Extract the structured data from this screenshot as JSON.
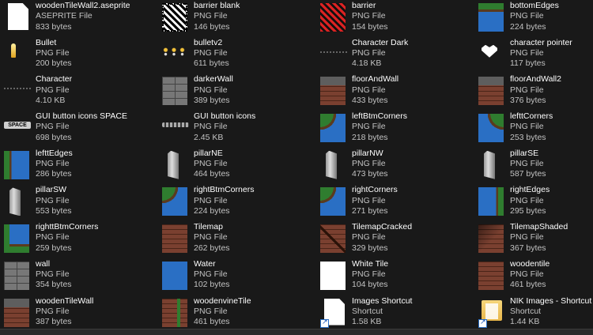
{
  "files": [
    {
      "name": "woodenTileWall2.aseprite",
      "type": "ASEPRITE File",
      "size": "833 bytes",
      "thumb": "doc"
    },
    {
      "name": "barrier blank",
      "type": "PNG File",
      "size": "146 bytes",
      "thumb": "blank"
    },
    {
      "name": "barrier",
      "type": "PNG File",
      "size": "154 bytes",
      "thumb": "barrier"
    },
    {
      "name": "bottomEdges",
      "type": "PNG File",
      "size": "224 bytes",
      "thumb": "grass-top"
    },
    {
      "name": "Bullet",
      "type": "PNG File",
      "size": "200 bytes",
      "thumb": "bullet"
    },
    {
      "name": "bulletv2",
      "type": "PNG File",
      "size": "611 bytes",
      "thumb": "bullets"
    },
    {
      "name": "Character Dark",
      "type": "PNG File",
      "size": "4.18 KB",
      "thumb": "strip"
    },
    {
      "name": "character pointer",
      "type": "PNG File",
      "size": "117 bytes",
      "thumb": "heart"
    },
    {
      "name": "Character",
      "type": "PNG File",
      "size": "4.10 KB",
      "thumb": "strip"
    },
    {
      "name": "darkerWall",
      "type": "PNG File",
      "size": "389 bytes",
      "thumb": "stone"
    },
    {
      "name": "floorAndWall",
      "type": "PNG File",
      "size": "433 bytes",
      "thumb": "wood-floor"
    },
    {
      "name": "floorAndWall2",
      "type": "PNG File",
      "size": "376 bytes",
      "thumb": "wood-floor"
    },
    {
      "name": "GUI button icons SPACE",
      "type": "PNG File",
      "size": "698 bytes",
      "thumb": "space",
      "thumb_text": "SPACE"
    },
    {
      "name": "GUI button icons",
      "type": "PNG File",
      "size": "2.45 KB",
      "thumb": "gui"
    },
    {
      "name": "leftBtmCorners",
      "type": "PNG File",
      "size": "218 bytes",
      "thumb": "corner-tl"
    },
    {
      "name": "lefttCorners",
      "type": "PNG File",
      "size": "253 bytes",
      "thumb": "corner-tr"
    },
    {
      "name": "lefttEdges",
      "type": "PNG File",
      "size": "286 bytes",
      "thumb": "grass-left"
    },
    {
      "name": "pillarNE",
      "type": "PNG File",
      "size": "464 bytes",
      "thumb": "pillar"
    },
    {
      "name": "pillarNW",
      "type": "PNG File",
      "size": "473 bytes",
      "thumb": "pillar"
    },
    {
      "name": "pillarSE",
      "type": "PNG File",
      "size": "587 bytes",
      "thumb": "pillar"
    },
    {
      "name": "pillarSW",
      "type": "PNG File",
      "size": "553 bytes",
      "thumb": "pillar"
    },
    {
      "name": "rightBtmCorners",
      "type": "PNG File",
      "size": "224 bytes",
      "thumb": "corner-tl"
    },
    {
      "name": "rightCorners",
      "type": "PNG File",
      "size": "271 bytes",
      "thumb": "corner-tl"
    },
    {
      "name": "rightEdges",
      "type": "PNG File",
      "size": "295 bytes",
      "thumb": "grass-right"
    },
    {
      "name": "righttBtmCorners",
      "type": "PNG File",
      "size": "259 bytes",
      "thumb": "corner-bl"
    },
    {
      "name": "Tilemap",
      "type": "PNG File",
      "size": "262 bytes",
      "thumb": "wood"
    },
    {
      "name": "TilemapCracked",
      "type": "PNG File",
      "size": "329 bytes",
      "thumb": "wood-crack"
    },
    {
      "name": "TilemapShaded",
      "type": "PNG File",
      "size": "367 bytes",
      "thumb": "wood-shade"
    },
    {
      "name": "wall",
      "type": "PNG File",
      "size": "354 bytes",
      "thumb": "stone"
    },
    {
      "name": "Water",
      "type": "PNG File",
      "size": "102 bytes",
      "thumb": "water"
    },
    {
      "name": "White Tile",
      "type": "PNG File",
      "size": "104 bytes",
      "thumb": "white"
    },
    {
      "name": "woodentile",
      "type": "PNG File",
      "size": "461 bytes",
      "thumb": "wood"
    },
    {
      "name": "woodenTileWall",
      "type": "PNG File",
      "size": "387 bytes",
      "thumb": "wood-floor"
    },
    {
      "name": "woodenvineTile",
      "type": "PNG File",
      "size": "461 bytes",
      "thumb": "wood-vine"
    },
    {
      "name": "Images Shortcut",
      "type": "Shortcut",
      "size": "1.58 KB",
      "thumb": "doc",
      "shortcut": true
    },
    {
      "name": "NIK Images - Shortcut",
      "type": "Shortcut",
      "size": "1.44 KB",
      "thumb": "folder",
      "shortcut": true
    }
  ]
}
